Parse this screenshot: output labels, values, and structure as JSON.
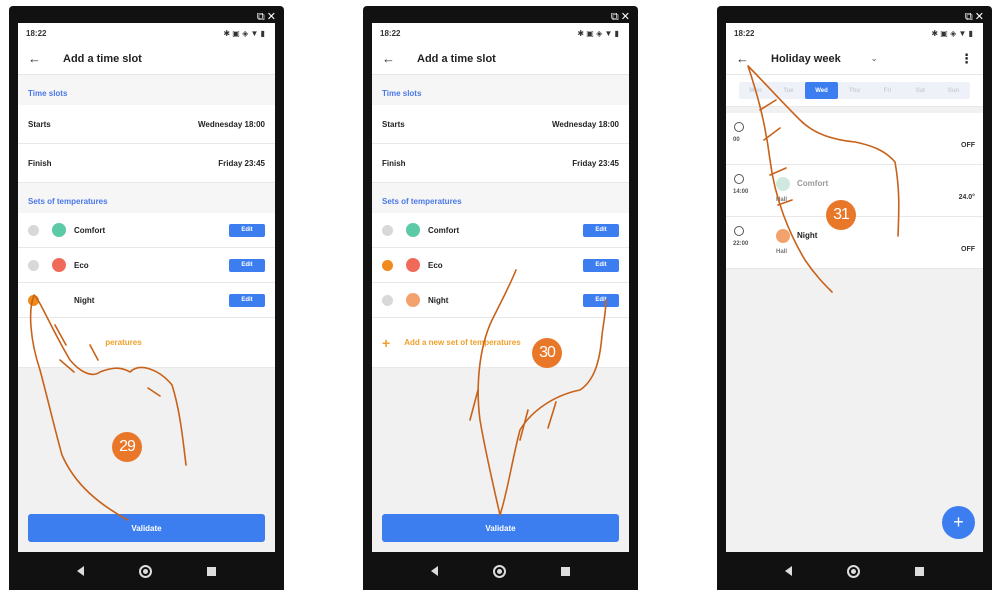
{
  "status_time": "18:22",
  "phone1": {
    "title": "Add a time slot",
    "section_slots": "Time slots",
    "starts_label": "Starts",
    "starts_value": "Wednesday 18:00",
    "finish_label": "Finish",
    "finish_value": "Friday 23:45",
    "section_sets": "Sets of temperatures",
    "sets": [
      {
        "name": "Comfort",
        "edit": "Edit",
        "selected": false,
        "icon_color": "#5cc9a7"
      },
      {
        "name": "Eco",
        "edit": "Edit",
        "selected": false,
        "icon_color": "#f06a5a"
      },
      {
        "name": "Night",
        "edit": "Edit",
        "selected": true,
        "icon_color": "#f3a26d"
      }
    ],
    "add_label": "peratures",
    "validate": "Validate",
    "step": "29"
  },
  "phone2": {
    "title": "Add a time slot",
    "section_slots": "Time slots",
    "starts_label": "Starts",
    "starts_value": "Wednesday 18:00",
    "finish_label": "Finish",
    "finish_value": "Friday 23:45",
    "section_sets": "Sets of temperatures",
    "sets": [
      {
        "name": "Comfort",
        "edit": "Edit",
        "selected": false,
        "icon_color": "#5cc9a7"
      },
      {
        "name": "Eco",
        "edit": "Edit",
        "selected": true,
        "icon_color": "#f06a5a"
      },
      {
        "name": "Night",
        "edit": "Edit",
        "selected": false,
        "icon_color": "#f3a26d"
      }
    ],
    "add_label": "Add a new set of temperatures",
    "validate": "Validate",
    "step": "30"
  },
  "phone3": {
    "title": "Holiday week",
    "days": [
      "Mon",
      "Tue",
      "Wed",
      "Thu",
      "Fri",
      "Sat",
      "Sun"
    ],
    "active_day": "Wed",
    "slots": [
      {
        "time": "00",
        "name": "",
        "zone": "",
        "value": "OFF",
        "icon_color": ""
      },
      {
        "time": "14:00",
        "name": "Comfort",
        "zone": "Hall",
        "value": "24.0°",
        "icon_color": "#cfe9df"
      },
      {
        "time": "22:00",
        "name": "Night",
        "zone": "Hall",
        "value": "OFF",
        "icon_color": "#f3a26d"
      }
    ],
    "fab": "+",
    "step": "31"
  },
  "colors": {
    "accent": "#3c7ef0",
    "selected": "#f08a1c",
    "step_badge": "#e9772a",
    "hand": "#c8621a"
  }
}
